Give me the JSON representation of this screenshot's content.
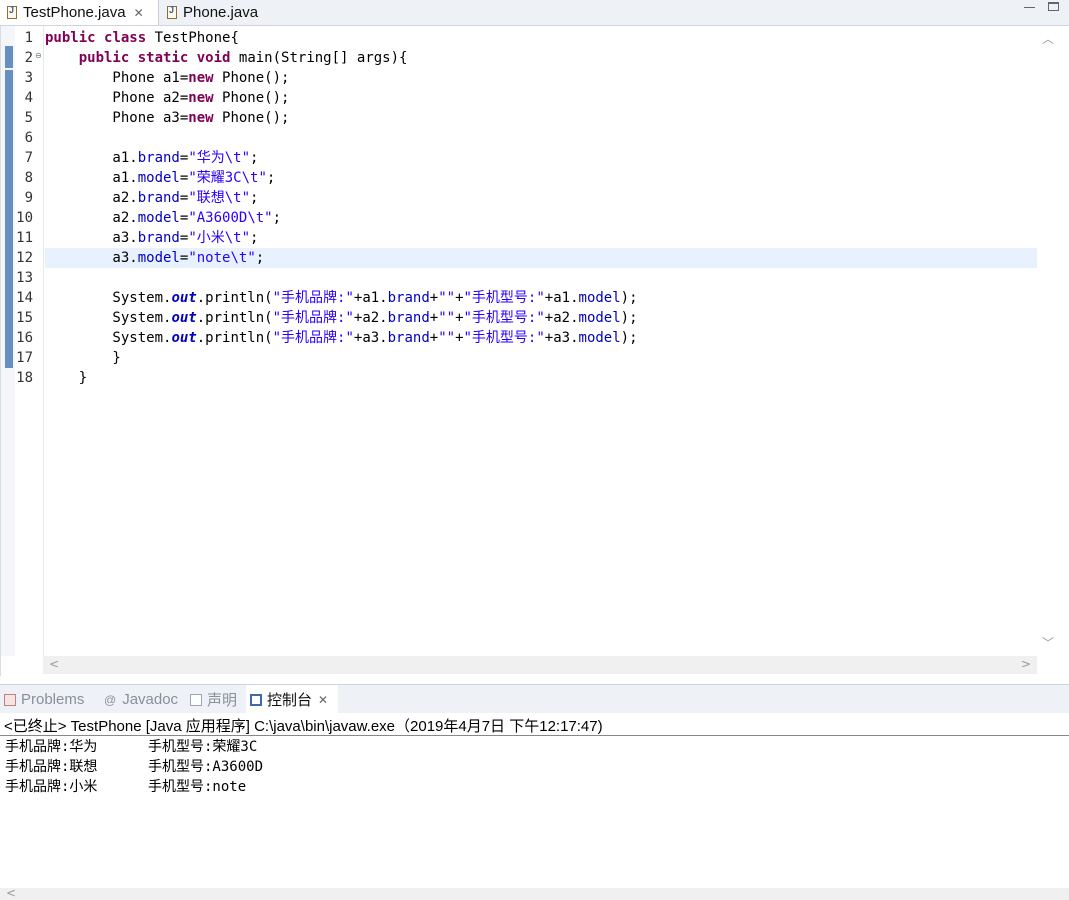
{
  "editor_tabs": [
    {
      "label": "TestPhone.java",
      "active": true
    },
    {
      "label": "Phone.java",
      "active": false
    }
  ],
  "code_lines": [
    {
      "n": "1",
      "html": "<span class='kw'>public</span> <span class='kw'>class</span> TestPhone{"
    },
    {
      "n": "2",
      "html": "    <span class='kw'>public</span> <span class='kw'>static</span> <span class='kw'>void</span> main(String[] args){"
    },
    {
      "n": "3",
      "html": "        Phone a1=<span class='kw'>new</span> Phone();"
    },
    {
      "n": "4",
      "html": "        Phone a2=<span class='kw'>new</span> Phone();"
    },
    {
      "n": "5",
      "html": "        Phone a3=<span class='kw'>new</span> Phone();"
    },
    {
      "n": "6",
      "html": ""
    },
    {
      "n": "7",
      "html": "        a1.<span class='fld'>brand</span>=<span class='str'>\"华为\\t\"</span>;"
    },
    {
      "n": "8",
      "html": "        a1.<span class='fld'>model</span>=<span class='str'>\"荣耀3C\\t\"</span>;"
    },
    {
      "n": "9",
      "html": "        a2.<span class='fld'>brand</span>=<span class='str'>\"联想\\t\"</span>;"
    },
    {
      "n": "10",
      "html": "        a2.<span class='fld'>model</span>=<span class='str'>\"A3600D\\t\"</span>;"
    },
    {
      "n": "11",
      "html": "        a3.<span class='fld'>brand</span>=<span class='str'>\"小米\\t\"</span>;"
    },
    {
      "n": "12",
      "html": "        a3.<span class='fld'>model</span>=<span class='str'>\"note\\t\"</span>;"
    },
    {
      "n": "13",
      "html": ""
    },
    {
      "n": "14",
      "html": "        System.<span class='sfld'>out</span>.println(<span class='str'>\"手机品牌:\"</span>+a1.<span class='fld'>brand</span>+<span class='str'>\"\"</span>+<span class='str'>\"手机型号:\"</span>+a1.<span class='fld'>model</span>);"
    },
    {
      "n": "15",
      "html": "        System.<span class='sfld'>out</span>.println(<span class='str'>\"手机品牌:\"</span>+a2.<span class='fld'>brand</span>+<span class='str'>\"\"</span>+<span class='str'>\"手机型号:\"</span>+a2.<span class='fld'>model</span>);"
    },
    {
      "n": "16",
      "html": "        System.<span class='sfld'>out</span>.println(<span class='str'>\"手机品牌:\"</span>+a3.<span class='fld'>brand</span>+<span class='str'>\"\"</span>+<span class='str'>\"手机型号:\"</span>+a3.<span class='fld'>model</span>);"
    },
    {
      "n": "17",
      "html": "        }"
    },
    {
      "n": "18",
      "html": "    }"
    }
  ],
  "current_line": "12",
  "view_tabs": [
    {
      "label": "Problems",
      "icon": "problems-icon",
      "active": false
    },
    {
      "label": "Javadoc",
      "icon": "javadoc-icon",
      "active": false
    },
    {
      "label": "声明",
      "icon": "declaration-icon",
      "active": false
    },
    {
      "label": "控制台",
      "icon": "console-icon",
      "active": true
    }
  ],
  "console": {
    "header": "<已终止> TestPhone [Java 应用程序] C:\\java\\bin\\javaw.exe（2019年4月7日 下午12:17:47)",
    "output": [
      "手机品牌:华为      手机型号:荣耀3C",
      "手机品牌:联想      手机型号:A3600D",
      "手机品牌:小米      手机型号:note"
    ]
  },
  "colors": {
    "keyword": "#7f0055",
    "string": "#2a00ff",
    "field": "#0000c0",
    "current_line": "#e8f2fe",
    "change_bar": "#4c7cb8"
  }
}
